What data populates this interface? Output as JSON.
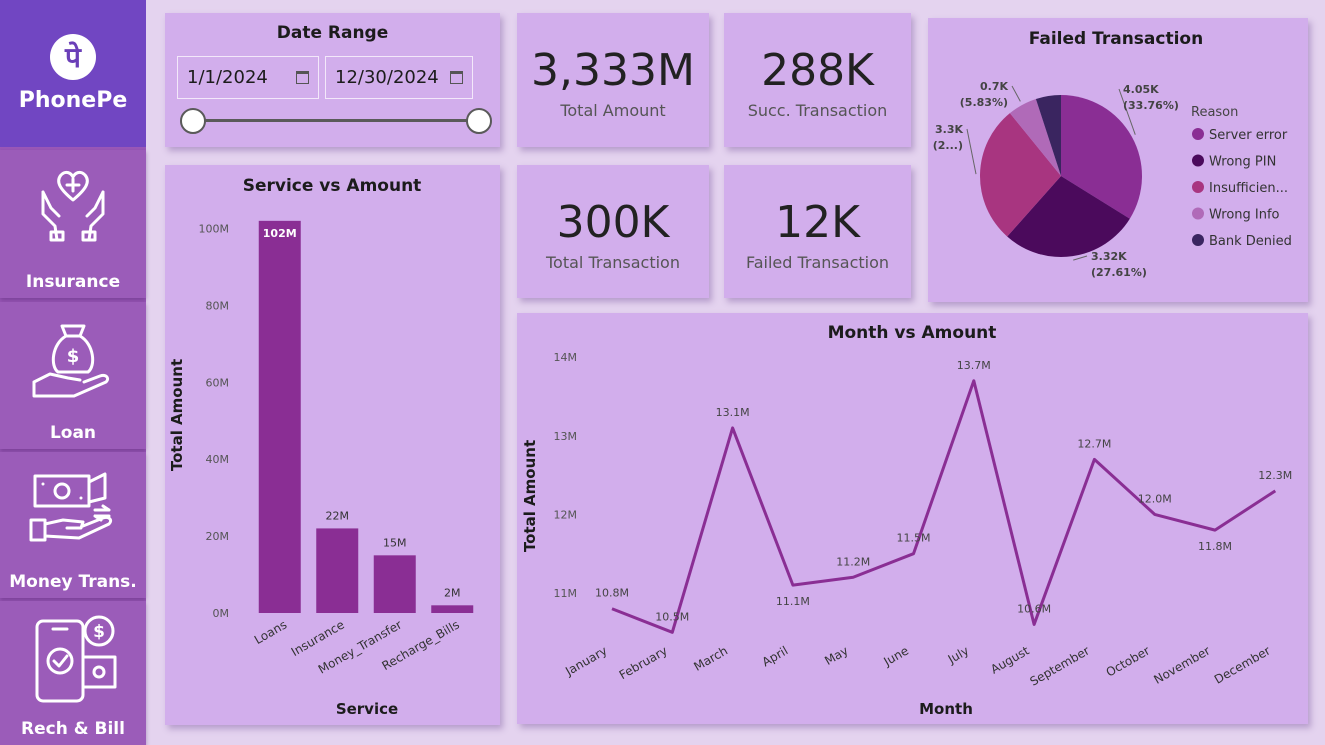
{
  "brand": {
    "name": "PhonePe",
    "logo_glyph": "पे"
  },
  "nav": [
    {
      "label": "Insurance",
      "icon": "insurance-heart-hands-icon"
    },
    {
      "label": "Loan",
      "icon": "loan-money-bag-icon"
    },
    {
      "label": "Money Trans.",
      "icon": "money-transfer-icon"
    },
    {
      "label": "Rech & Bill",
      "icon": "recharge-bill-phone-icon"
    }
  ],
  "date_range": {
    "title": "Date Range",
    "start": "1/1/2024",
    "end": "12/30/2024"
  },
  "kpis": [
    {
      "value": "3,333M",
      "label": "Total Amount"
    },
    {
      "value": "288K",
      "label": "Succ. Transaction"
    },
    {
      "value": "300K",
      "label": "Total Transaction"
    },
    {
      "value": "12K",
      "label": "Failed Transaction"
    }
  ],
  "colors": {
    "bar": "#8a2e94",
    "line": "#8a2e94",
    "card": "#d2aeec",
    "sidebar": "#9a58b8",
    "logo_bg": "#7146c2"
  },
  "chart_data": [
    {
      "type": "bar",
      "title": "Service vs Amount",
      "xlabel": "Service",
      "ylabel": "Total Amount",
      "categories": [
        "Loans",
        "Insurance",
        "Money_Transfer",
        "Recharge_Bills"
      ],
      "values": [
        102,
        22,
        15,
        2
      ],
      "data_labels": [
        "102M",
        "22M",
        "15M",
        "2M"
      ],
      "yticks": [
        "0M",
        "20M",
        "40M",
        "60M",
        "80M",
        "100M"
      ],
      "ylim": [
        0,
        103
      ],
      "grid": false
    },
    {
      "type": "pie",
      "title": "Failed Transaction",
      "legend_title": "Reason",
      "legend_position": "right",
      "slices": [
        {
          "name": "Server error",
          "value": 4.05,
          "label": "4.05K",
          "pct": "(33.76%)",
          "color": "#8a2e94"
        },
        {
          "name": "Wrong PIN",
          "value": 3.32,
          "label": "3.32K",
          "pct": "(27.61%)",
          "color": "#4b0a5c"
        },
        {
          "name": "Insufficien...",
          "value": 3.3,
          "label": "3.3K",
          "pct": "(2...)",
          "color": "#a83580"
        },
        {
          "name": "Wrong Info",
          "value": 0.7,
          "label": "0.7K",
          "pct": "(5.83%)",
          "color": "#b06ab8"
        },
        {
          "name": "Bank Denied",
          "value": 0.6,
          "label": "",
          "pct": "",
          "color": "#3a2560"
        }
      ]
    },
    {
      "type": "line",
      "title": "Month vs Amount",
      "xlabel": "Month",
      "ylabel": "Total Amount",
      "categories": [
        "January",
        "February",
        "March",
        "April",
        "May",
        "June",
        "July",
        "August",
        "September",
        "October",
        "November",
        "December"
      ],
      "values": [
        10.8,
        10.5,
        13.1,
        11.1,
        11.2,
        11.5,
        13.7,
        10.6,
        12.7,
        12.0,
        11.8,
        12.3
      ],
      "data_labels": [
        "10.8M",
        "10.5M",
        "13.1M",
        "11.1M",
        "11.2M",
        "11.5M",
        "13.7M",
        "10.6M",
        "12.7M",
        "12.0M",
        "11.8M",
        "12.3M"
      ],
      "yticks": [
        "11M",
        "12M",
        "13M",
        "14M"
      ],
      "ylim": [
        10.5,
        14
      ],
      "grid": false
    }
  ]
}
